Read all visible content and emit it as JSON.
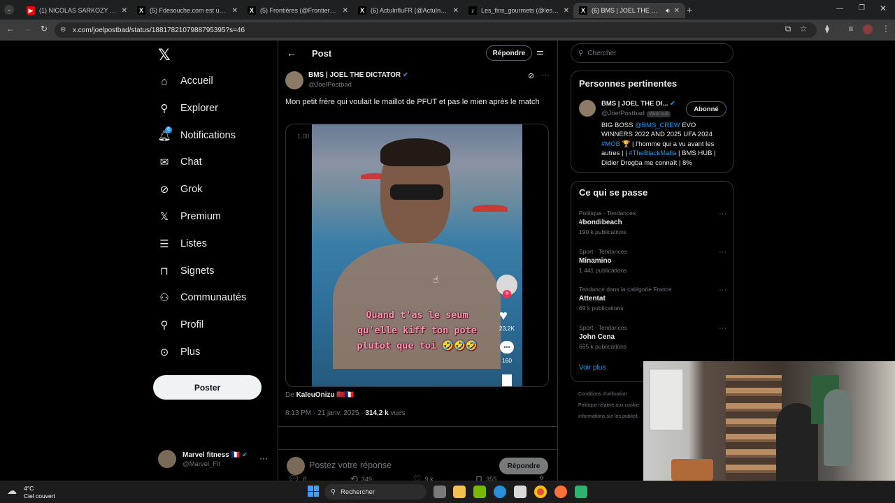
{
  "browser": {
    "tabs": [
      {
        "title": "(1) NICOLAS SARKOZY : INTERV",
        "color": "#ff0000",
        "glyph": "▶"
      },
      {
        "title": "(5) Fdesouche.com est une rev",
        "color": "#000000",
        "glyph": "X"
      },
      {
        "title": "(5) Frontières (@Frontieresme",
        "color": "#000000",
        "glyph": "X"
      },
      {
        "title": "(6) ActuInfluFR (@ActuInfluFR)",
        "color": "#000000",
        "glyph": "X"
      },
      {
        "title": "Les_fins_gourmets (@les_fins_g",
        "color": "#000000",
        "glyph": "♪"
      },
      {
        "title": "(6) BMS | JOEL THE DICTAT",
        "color": "#000000",
        "glyph": "X"
      }
    ],
    "url": "x.com/joelpostbad/status/1881782107988795395?s=46"
  },
  "nav": {
    "items": [
      {
        "label": "Accueil",
        "icon": "home-icon"
      },
      {
        "label": "Explorer",
        "icon": "search-icon"
      },
      {
        "label": "Notifications",
        "icon": "bell-icon",
        "badge": "6"
      },
      {
        "label": "Chat",
        "icon": "mail-icon"
      },
      {
        "label": "Grok",
        "icon": "grok-icon"
      },
      {
        "label": "Premium",
        "icon": "x-logo-icon"
      },
      {
        "label": "Listes",
        "icon": "list-icon"
      },
      {
        "label": "Signets",
        "icon": "bookmark-icon"
      },
      {
        "label": "Communautés",
        "icon": "communities-icon"
      },
      {
        "label": "Profil",
        "icon": "person-icon"
      },
      {
        "label": "Plus",
        "icon": "more-circle-icon"
      }
    ],
    "post_button": "Poster",
    "account": {
      "name": "Marvel fitness 🇫🇷",
      "handle": "@Marvel_Fit"
    }
  },
  "post": {
    "header_title": "Post",
    "reply_button": "Répondre",
    "author_name": "BMS | JOEL THE DICTATOR",
    "author_handle": "@JoelPostbad",
    "text": "Mon petit frère qui voulait le maillot de PFUT et pas le mien après le match",
    "video": {
      "speed": "1.00",
      "caption": "Quand t'as le seum qu'elle kiff ton pote plutot que toi 🤣🤣🤣",
      "likes": "23,2K",
      "comments": "160"
    },
    "from_label": "De",
    "from_user": "KaïeuOnizu 🇲🇦🇫🇷",
    "time": "8:13 PM · 21 janv. 2025 · ",
    "views_count": "314,2 k",
    "views_label": " vues",
    "actions": {
      "replies": "6",
      "reposts": "349",
      "likes": "9 k",
      "bookmarks": "355"
    },
    "reply_placeholder": "Postez votre réponse",
    "reply_submit": "Répondre"
  },
  "search": {
    "placeholder": "Chercher"
  },
  "relevant": {
    "title": "Personnes pertinentes",
    "name": "BMS | JOEL THE DI...",
    "handle": "@JoelPostbad",
    "follows_you": "Vous suit",
    "follow_state": "Abonné",
    "bio_1": "BIG BOSS ",
    "bio_mention": "@BMS_CREW",
    "bio_2": " EVO WINNERS 2022 AND 2025 UFA 2024 ",
    "bio_tag1": "#MOB",
    "bio_3": " 🏆 | l'homme qui a vu avant les autres | | ",
    "bio_tag2": "#TheBlackMafia",
    "bio_4": " | BMS HUB | Didier Drogba me connaît | 8%"
  },
  "trending": {
    "title": "Ce qui se passe",
    "items": [
      {
        "meta": "Politique · Tendances",
        "name": "#bondibeach",
        "count": "190 k publications"
      },
      {
        "meta": "Sport · Tendances",
        "name": "Minamino",
        "count": "1 441 publications"
      },
      {
        "meta": "Tendance dans la catégorie France",
        "name": "Attentat",
        "count": "69 k publications"
      },
      {
        "meta": "Sport · Tendances",
        "name": "John Cena",
        "count": "665 k publications"
      }
    ],
    "show_more": "Voir plus"
  },
  "footer_links": [
    "Conditions d'utilisation",
    "Politique relative aux cookie",
    "Informations sur les publicit"
  ],
  "taskbar": {
    "weather_temp": "4°C",
    "weather_desc": "Ciel couvert",
    "search": "Rechercher"
  }
}
